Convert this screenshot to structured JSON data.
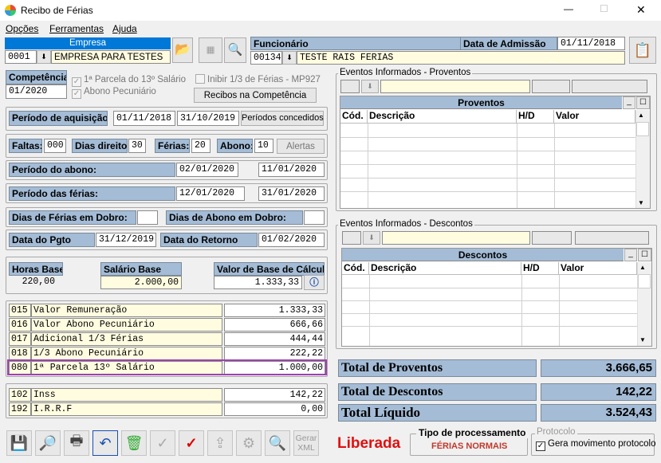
{
  "window": {
    "title": "Recibo de Férias",
    "min": "—",
    "max": "☐",
    "close": "✕"
  },
  "menu": [
    "Opções",
    "Ferramentas",
    "Ajuda"
  ],
  "empresa": {
    "label": "Empresa",
    "code": "0001",
    "name": "EMPRESA PARA TESTES"
  },
  "funcionario": {
    "label": "Funcionário",
    "code": "00134",
    "name": "TESTE RAIS FERIAS",
    "admissao_label": "Data de Admissão",
    "admissao": "01/11/2018"
  },
  "competencia": {
    "label": "Competência",
    "value": "01/2020"
  },
  "checks": {
    "parcela13": "1ª Parcela do 13º Salário",
    "abono": "Abono Pecuniário",
    "inibir": "Inibir 1/3 de Férias - MP927"
  },
  "recibos_btn": "Recibos na Competência",
  "aquisicao": {
    "label": "Período de aquisição:",
    "start": "01/11/2018",
    "end": "31/10/2019",
    "btn": "Períodos concedidos"
  },
  "faltas": {
    "label": "Faltas:",
    "value": "000",
    "dias_label": "Dias direito:",
    "dias": "30",
    "ferias_label": "Férias:",
    "ferias": "20",
    "abono_label": "Abono:",
    "abono": "10",
    "alertas": "Alertas"
  },
  "periodo_abono": {
    "label": "Período do abono:",
    "start": "02/01/2020",
    "end": "11/01/2020"
  },
  "periodo_ferias": {
    "label": "Período das férias:",
    "start": "12/01/2020",
    "end": "31/01/2020"
  },
  "dobro": {
    "ferias_label": "Dias de Férias em Dobro:",
    "ferias": "",
    "abono_label": "Dias de Abono em Dobro:",
    "abono": ""
  },
  "pgto": {
    "label": "Data do Pgto",
    "value": "31/12/2019",
    "retorno_label": "Data do Retorno",
    "retorno": "01/02/2020"
  },
  "base": {
    "horas_label": "Horas Base",
    "horas": "220,00",
    "salario_label": "Salário Base",
    "salario": "2.000,00",
    "calc_label": "Valor de Base de Cálculo",
    "calc": "1.333,33"
  },
  "eventos": [
    {
      "code": "015",
      "desc": "Valor Remuneração",
      "value": "1.333,33"
    },
    {
      "code": "016",
      "desc": "Valor Abono Pecuniário",
      "value": "666,66"
    },
    {
      "code": "017",
      "desc": "Adicional 1/3 Férias",
      "value": "444,44"
    },
    {
      "code": "018",
      "desc": "1/3 Abono Pecuniário",
      "value": "222,22"
    },
    {
      "code": "080",
      "desc": "1ª Parcela 13º Salário",
      "value": "1.000,00"
    }
  ],
  "descontos_list": [
    {
      "code": "102",
      "desc": "Inss",
      "value": "142,22"
    },
    {
      "code": "192",
      "desc": "I.R.R.F",
      "value": "0,00"
    }
  ],
  "proventos_panel": {
    "title": "Eventos Informados - Proventos",
    "grid_title": "Proventos",
    "cols": [
      "Cód.",
      "Descrição",
      "H/D",
      "Valor"
    ]
  },
  "descontos_panel": {
    "title": "Eventos Informados - Descontos",
    "grid_title": "Descontos",
    "cols": [
      "Cód.",
      "Descrição",
      "H/D",
      "Valor"
    ]
  },
  "totais": {
    "proventos_label": "Total de Proventos",
    "proventos": "3.666,65",
    "descontos_label": "Total de Descontos",
    "descontos": "142,22",
    "liquido_label": "Total Líquido",
    "liquido": "3.524,43"
  },
  "status": {
    "liberada": "Liberada",
    "tipo_label": "Tipo de processamento",
    "tipo": "FÉRIAS NORMAIS",
    "protocolo_label": "Protocolo",
    "protocolo_chk": "Gera movimento protocolo"
  },
  "toolbar": {
    "gerar": "Gerar\nXML"
  },
  "colors": {
    "label_bg": "#a4bcd6",
    "highlight": "#a040b0",
    "liberada": "#e01010",
    "tipo": "#c0392b"
  }
}
